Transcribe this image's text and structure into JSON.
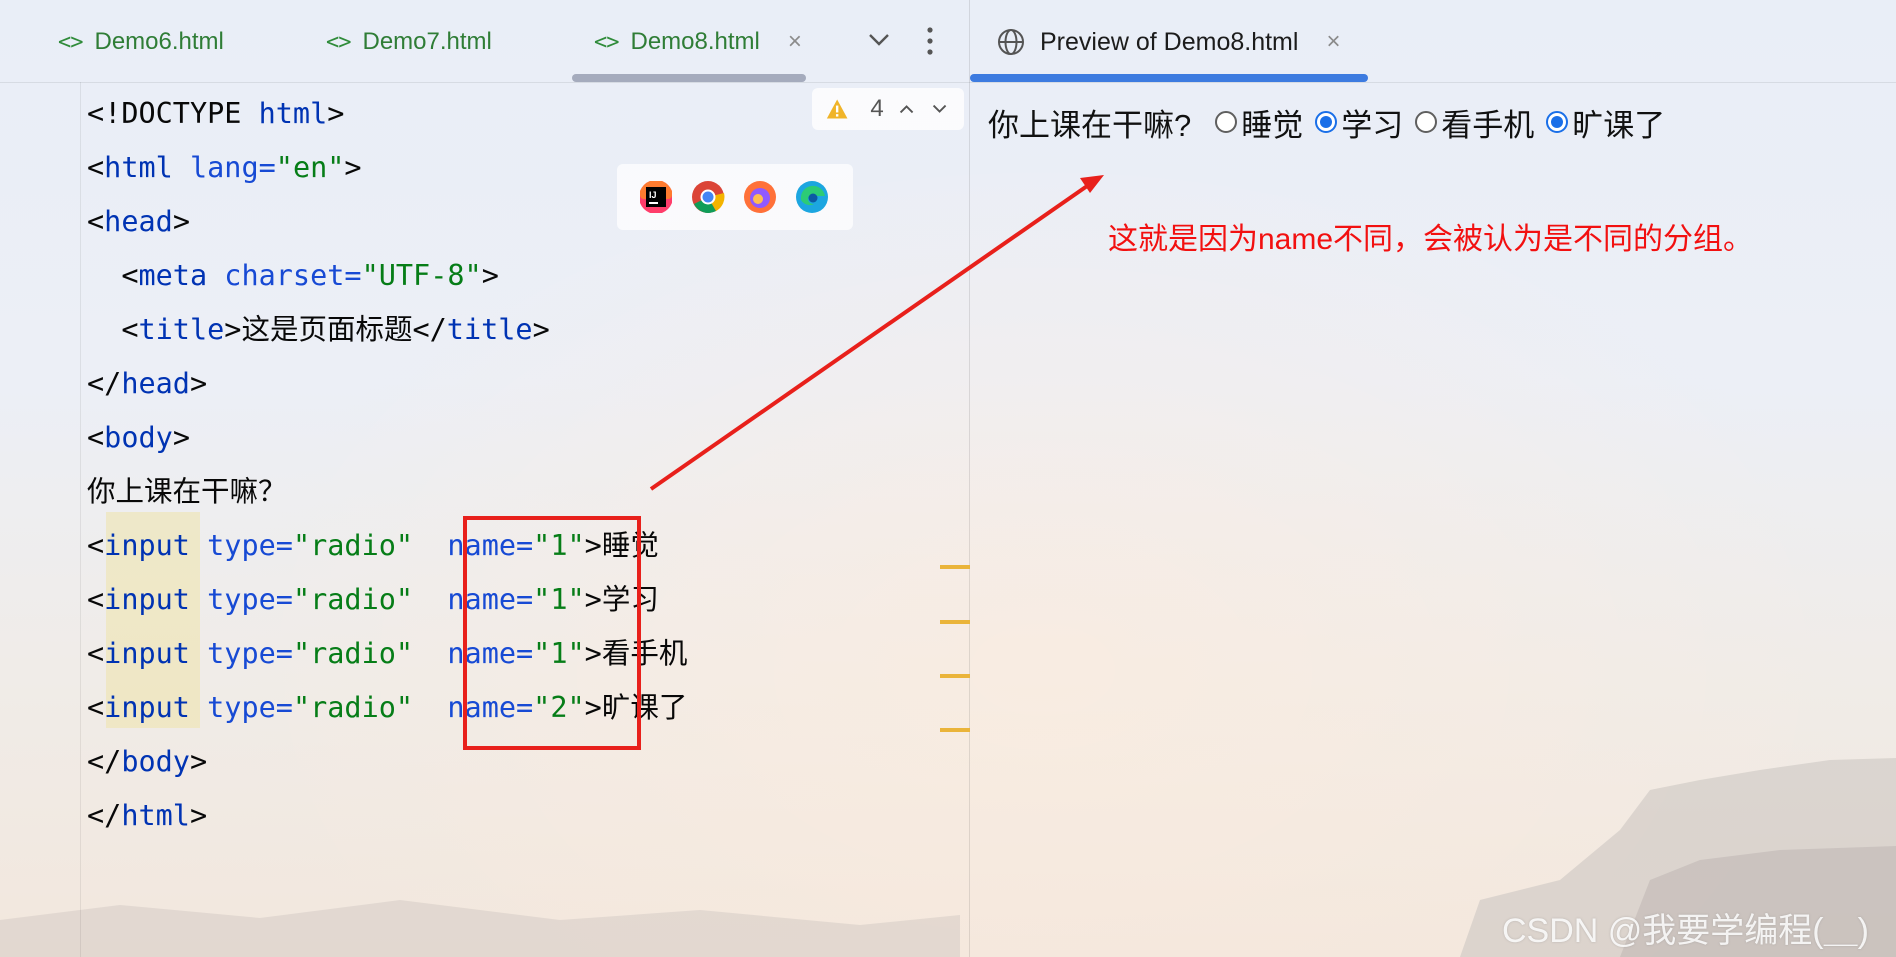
{
  "tabs": [
    {
      "label": "Demo6.html"
    },
    {
      "label": "Demo7.html"
    },
    {
      "label": "Demo8.html",
      "close": "×"
    }
  ],
  "preview_tab": {
    "label": "Preview of Demo8.html",
    "close": "×"
  },
  "warnings": {
    "count": "4"
  },
  "editor": {
    "doctype": "<!DOCTYPE ",
    "doctype_kw": "html",
    "body_text": "你上课在干嘛？",
    "title_text": "这是页面标题",
    "options": [
      {
        "name_value": "\"1\"",
        "label": "睡觉"
      },
      {
        "name_value": "\"1\"",
        "label": "学习"
      },
      {
        "name_value": "\"1\"",
        "label": "看手机"
      },
      {
        "name_value": "\"2\"",
        "label": "旷课了"
      }
    ]
  },
  "preview": {
    "question": "你上课在干嘛?",
    "options": [
      {
        "label": "睡觉",
        "checked": false
      },
      {
        "label": "学习",
        "checked": true
      },
      {
        "label": "看手机",
        "checked": false
      },
      {
        "label": "旷课了",
        "checked": true
      }
    ]
  },
  "annotation": "这就是因为name不同，会被认为是不同的分组。",
  "watermark": "CSDN @我要学编程(＿)",
  "colors": {
    "annotation": "#f21010",
    "tag": "#0033b3",
    "string": "#067d17",
    "active_tab": "#3d7be0"
  }
}
